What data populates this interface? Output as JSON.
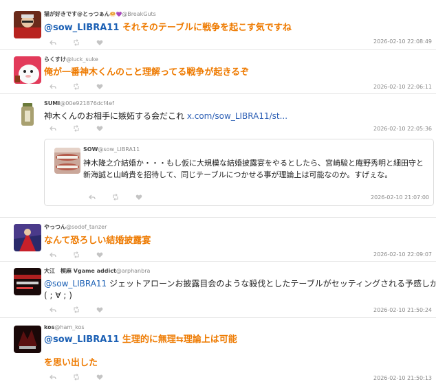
{
  "posts": [
    {
      "display_name": "猫が好きです@とっつぁん",
      "handle": "@BreakGuts",
      "mention": "@sow_LIBRA11",
      "text": " それそのテーブルに戦争を起こす気ですね",
      "timestamp": "2026-02-10 22:08:49"
    },
    {
      "display_name": "らくすけ",
      "handle": "@luck_suke",
      "text": "俺が一番神木くんのこと理解ってる戦争が起きるぞ",
      "timestamp": "2026-02-10 22:06:11"
    },
    {
      "display_name": "SUMI",
      "handle": "@00e921876dcf4ef",
      "text": "神木くんのお相手に嫉妬する会だこれ ",
      "link": "x.com/sow_LIBRA11/st...",
      "timestamp": "2026-02-10 22:05:36",
      "quote": {
        "display_name": "SOW",
        "handle": "@sow_LIBRA11",
        "text": "神木隆之介結婚か・・・もし仮に大規模な結婚披露宴をやるとしたら、宮崎駿と庵野秀明と細田守と新海誠と山崎貴を招待して、同じテーブルにつかせる事が理論上は可能なのか。すげぇな。",
        "timestamp": "2026-02-10 21:07:00"
      }
    },
    {
      "display_name": "やっつん",
      "handle": "@sodof_tanzer",
      "text": "なんて恐ろしい結婚披露宴",
      "timestamp": "2026-02-10 22:09:07"
    },
    {
      "display_name": "大江　楔麻 Vgame addict",
      "handle": "@arphanbra",
      "mention": "@sow_LIBRA11",
      "text": " ジェットアローンお披露目会のような殺伐としたテーブルがセッティングされる予感しか",
      "text2": "( ; ∀ ; )",
      "timestamp": "2026-02-10 21:50:24"
    },
    {
      "display_name": "kos",
      "handle": "@ham_kos",
      "mention": "@sow_LIBRA11",
      "text": " 生理的に無理⇆理論上は可能",
      "text2": "を思い出した",
      "timestamp": "2026-02-10 21:50:13"
    }
  ],
  "colors": {
    "accent_orange": "#ee7a00",
    "mention_blue": "#1a5fb4",
    "icon_gray": "#c4c4c4"
  }
}
